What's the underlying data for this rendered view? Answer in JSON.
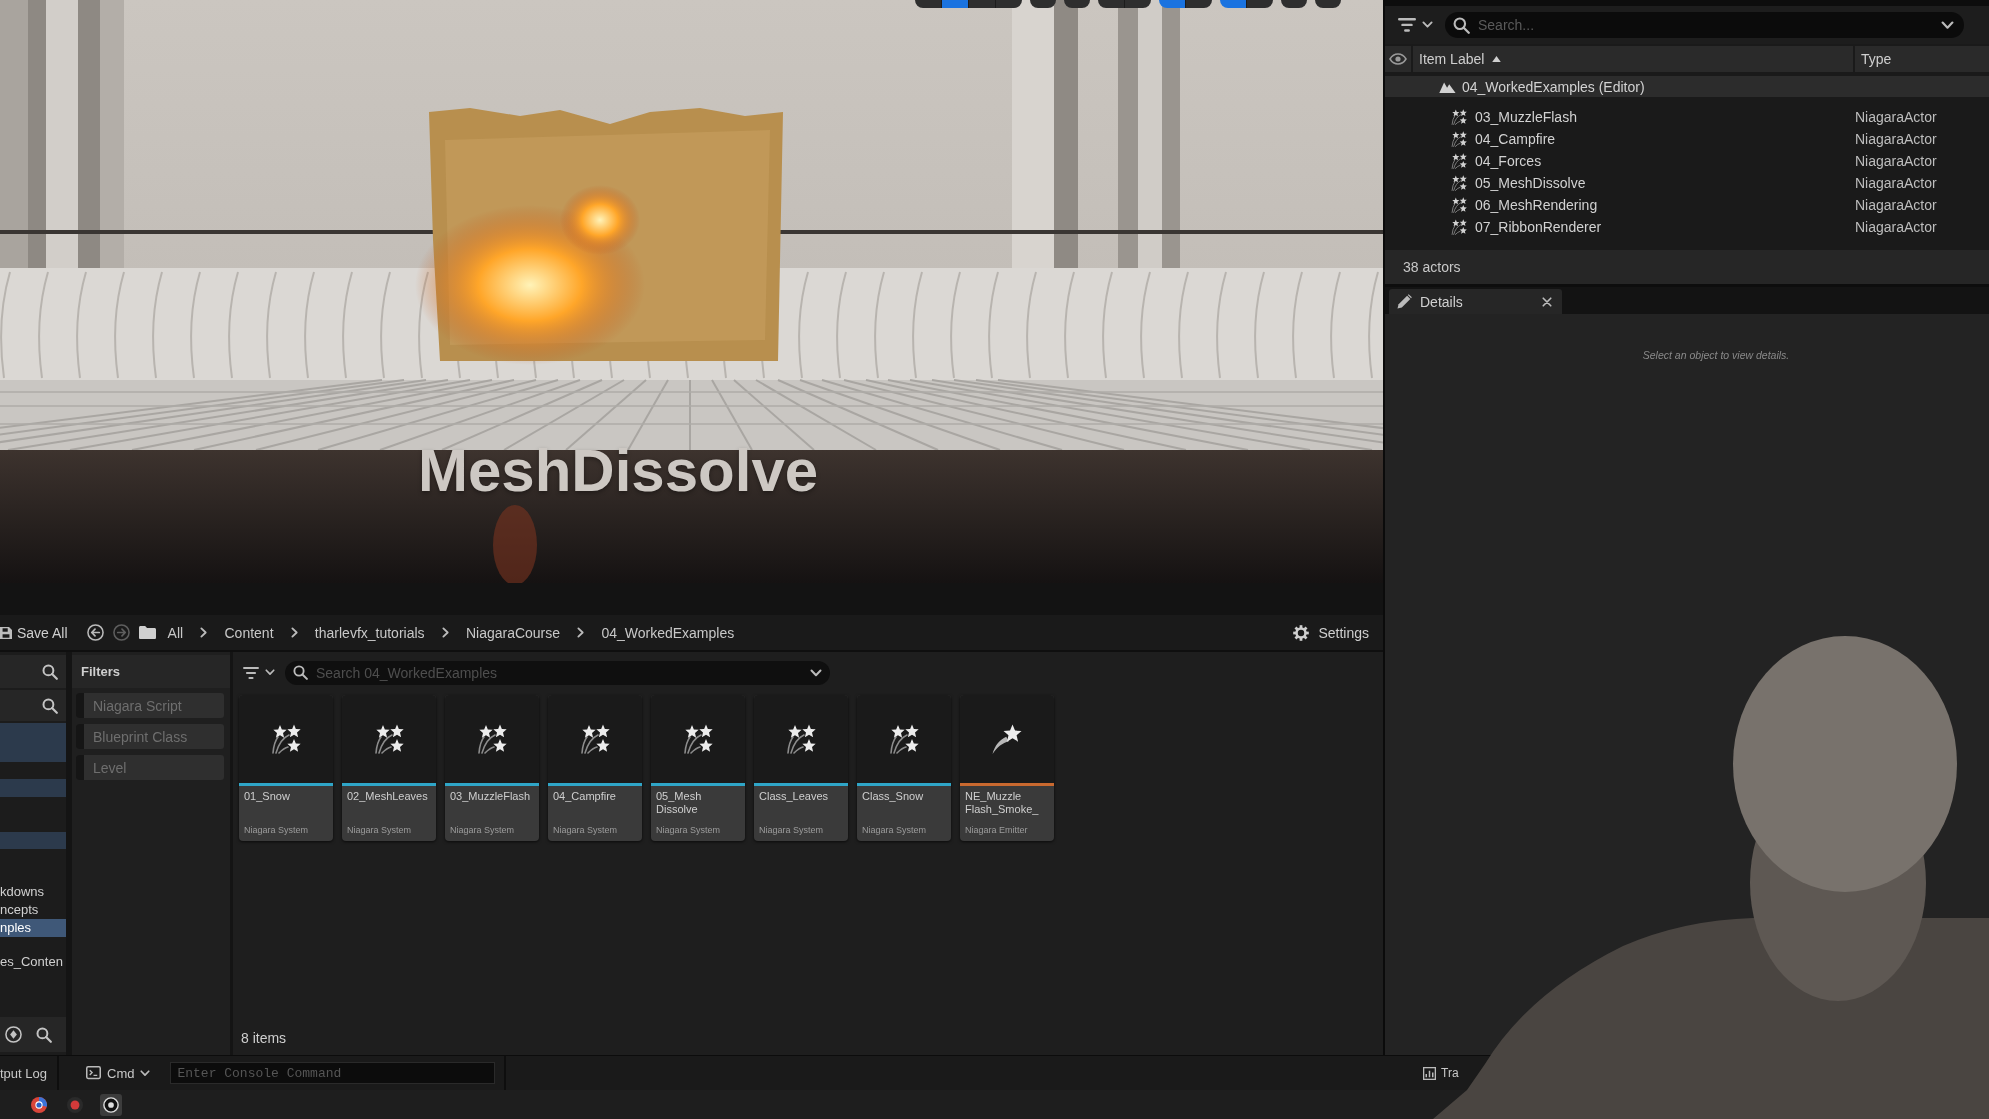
{
  "viewport": {
    "toolbar": [
      {
        "buttons": [
          {
            "selected": false
          },
          {
            "selected": true
          },
          {
            "selected": false
          },
          {
            "selected": false
          }
        ]
      },
      {
        "buttons": [
          {
            "selected": false
          }
        ]
      },
      {
        "buttons": [
          {
            "selected": false
          }
        ]
      },
      {
        "buttons": [
          {
            "selected": false
          },
          {
            "selected": false
          }
        ]
      },
      {
        "buttons": [
          {
            "selected": true
          },
          {
            "selected": false
          }
        ]
      },
      {
        "buttons": [
          {
            "selected": true
          },
          {
            "selected": false
          }
        ]
      },
      {
        "buttons": [
          {
            "selected": false
          }
        ]
      },
      {
        "buttons": [
          {
            "selected": false
          }
        ]
      }
    ],
    "scene_text": "MeshDissolve"
  },
  "outliner": {
    "search": {
      "placeholder": "Search..."
    },
    "columns": [
      {
        "label": "Item Label",
        "sorted": true
      },
      {
        "label": "Type",
        "sorted": false
      }
    ],
    "tree": [
      {
        "label": "04_WorkedExamples (Editor)",
        "kind": "level",
        "children": [
          {
            "label": "03_MuzzleFlash",
            "type": "NiagaraActor",
            "kind": "niagara_actor"
          },
          {
            "label": "04_Campfire",
            "type": "NiagaraActor",
            "kind": "niagara_actor"
          },
          {
            "label": "04_Forces",
            "type": "NiagaraActor",
            "kind": "niagara_actor"
          },
          {
            "label": "05_MeshDissolve",
            "type": "NiagaraActor",
            "kind": "niagara_actor"
          },
          {
            "label": "06_MeshRendering",
            "type": "NiagaraActor",
            "kind": "niagara_actor"
          },
          {
            "label": "07_RibbonRenderer",
            "type": "NiagaraActor",
            "kind": "niagara_actor"
          }
        ]
      }
    ],
    "status": "38 actors"
  },
  "details": {
    "tab": "Details",
    "hint": "Select an object to view details."
  },
  "content_browser": {
    "toolbar": {
      "save_label": "Save All",
      "breadcrumbs": [
        "All",
        "Content",
        "tharlevfx_tutorials",
        "NiagaraCourse",
        "04_WorkedExamples"
      ],
      "settings_label": "Settings"
    },
    "sources": {
      "items": [
        {
          "label": "kdowns",
          "selected": false
        },
        {
          "label": "ncepts",
          "selected": false
        },
        {
          "label": "nples",
          "selected": true
        },
        {
          "label": "es_Conten",
          "selected": false
        }
      ]
    },
    "filters": {
      "title": "Filters",
      "items": [
        {
          "label": "Niagara Script",
          "checked": false
        },
        {
          "label": "Blueprint Class",
          "checked": false
        },
        {
          "label": "Level",
          "checked": false
        }
      ]
    },
    "search": {
      "placeholder": "Search 04_WorkedExamples"
    },
    "assets": [
      {
        "name": "01_Snow",
        "type": "Niagara System",
        "kind": "system"
      },
      {
        "name": "02_MeshLeaves",
        "type": "Niagara System",
        "kind": "system"
      },
      {
        "name": "03_MuzzleFlash",
        "type": "Niagara System",
        "kind": "system"
      },
      {
        "name": "04_Campfire",
        "type": "Niagara System",
        "kind": "system"
      },
      {
        "name": "05_Mesh Dissolve",
        "type": "Niagara System",
        "kind": "system"
      },
      {
        "name": "Class_Leaves",
        "type": "Niagara System",
        "kind": "system"
      },
      {
        "name": "Class_Snow",
        "type": "Niagara System",
        "kind": "system"
      },
      {
        "name": "NE_Muzzle Flash_Smoke_",
        "type": "Niagara Emitter",
        "kind": "emitter"
      }
    ],
    "item_count": "8 items"
  },
  "status_bar": {
    "output_log": "tput Log",
    "cmd": "Cmd",
    "console": {
      "placeholder": "Enter Console Command"
    },
    "trace": "Tra"
  },
  "taskbar": {
    "apps": [
      {
        "kind": "browser",
        "selected": false
      },
      {
        "kind": "recorder",
        "selected": false
      },
      {
        "kind": "engine",
        "selected": true
      }
    ]
  }
}
